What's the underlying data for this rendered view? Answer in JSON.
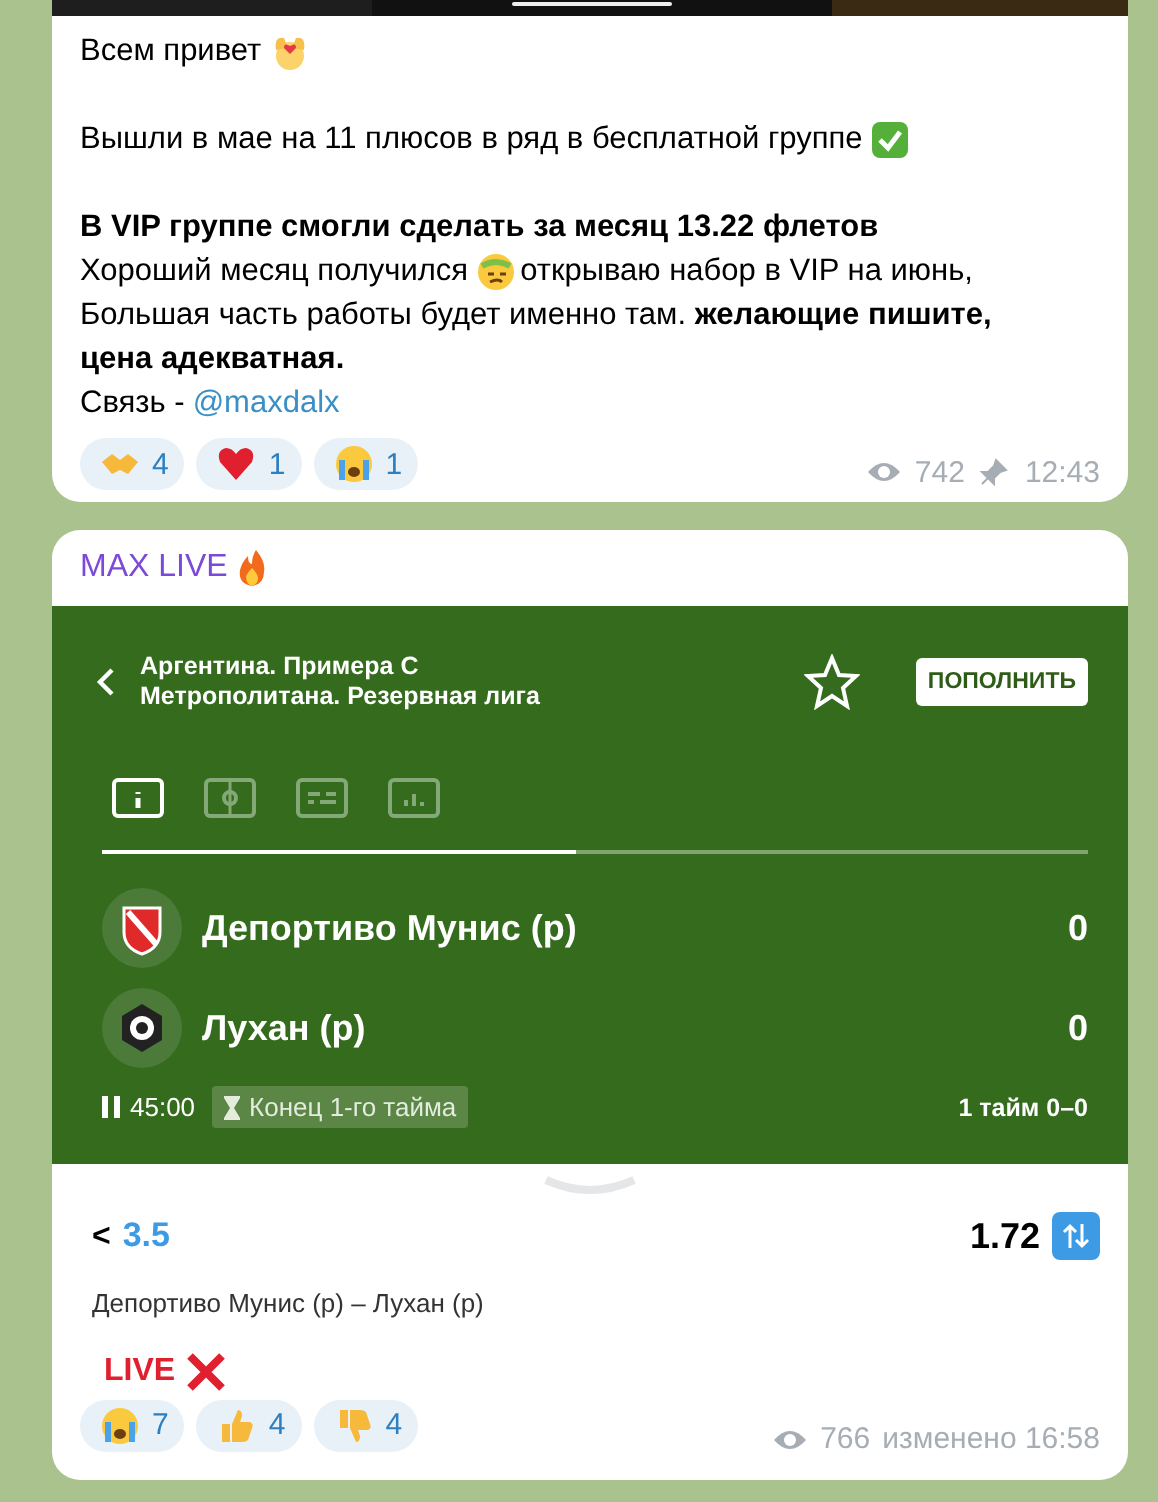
{
  "post1": {
    "lines": [
      {
        "parts": [
          {
            "kind": "text",
            "text": "Всем привет"
          },
          {
            "kind": "emoji"
          }
        ]
      },
      {
        "kind": "blank"
      },
      {
        "parts": [
          {
            "kind": "text",
            "text": "Вышли в мае на 11 плюсов в ряд в бесплатной группе"
          },
          {
            "kind": "emoji"
          }
        ]
      },
      {
        "kind": "blank"
      },
      {
        "parts": [
          {
            "kind": "bold",
            "text": "В VIP группе смогли сделать за месяц 13.22 флетов"
          }
        ]
      },
      {
        "parts": [
          {
            "kind": "text",
            "text": "Хороший месяц получился"
          },
          {
            "kind": "emoji"
          },
          {
            "kind": "text",
            "text": "открываю набор в VIP на июнь,"
          }
        ]
      },
      {
        "parts": [
          {
            "kind": "text",
            "text": "Большая часть работы будет именно там. **желающие пишите,**"
          }
        ]
      },
      {
        "parts": [
          {
            "kind": "bold",
            "text": "цена адекватная."
          }
        ]
      },
      {
        "parts": [
          {
            "kind": "text",
            "text": "Связь - "
          },
          {
            "kind": "link",
            "text": "@maxdalx"
          }
        ]
      }
    ],
    "reactions": [
      {
        "count": "4"
      },
      {
        "count": "1"
      },
      {
        "count": "1"
      }
    ],
    "views": "742",
    "time": "12:43"
  },
  "post2": {
    "author": "MAX LIVE",
    "card": {
      "league": "Аргентина. Примера С Метрополитана. Резервная лига",
      "action": "ПОПОЛНИТЬ",
      "tabs": [
        {
          "selected": true
        },
        {
          "selected": false
        },
        {
          "selected": false
        },
        {
          "selected": false
        }
      ],
      "progress": {
        "level": 0.48
      },
      "teams": [
        {
          "name": "Депортиво Мунис (р)",
          "score": "0"
        },
        {
          "name": "Лухан (р)",
          "score": "0"
        }
      ],
      "clock": "45:00",
      "period": "Конец 1-го тайма",
      "half_score": "1 тайм 0–0"
    },
    "bet": {
      "sign": "<",
      "line": "3.5",
      "odds": "1.72",
      "match": "Депортиво Мунис (р) – Лухан (р)",
      "result": "LIVE"
    },
    "reactions": [
      {
        "count": "7"
      },
      {
        "count": "4"
      },
      {
        "count": "4"
      }
    ],
    "views": "766",
    "time": "изменено 16:58"
  }
}
